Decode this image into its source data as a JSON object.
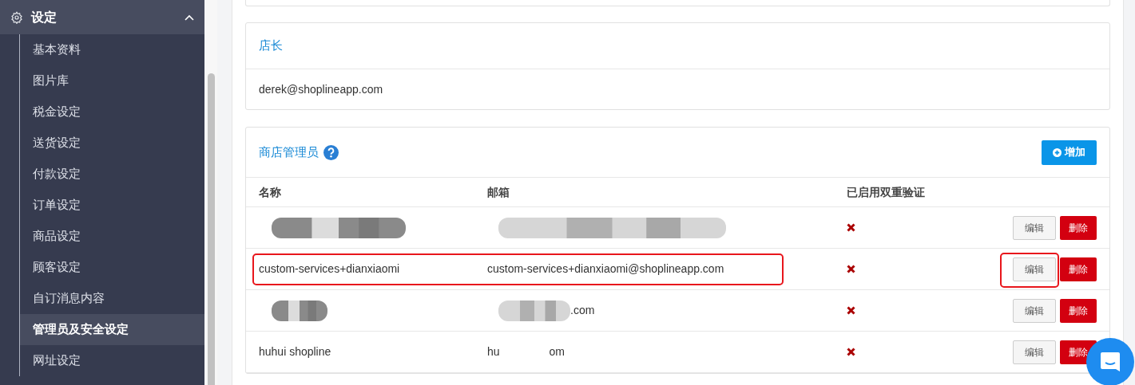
{
  "sidebar": {
    "section": {
      "label": "设定",
      "expanded": true
    },
    "items": [
      {
        "label": "基本资料",
        "selected": false
      },
      {
        "label": "图片库",
        "selected": false
      },
      {
        "label": "税金设定",
        "selected": false
      },
      {
        "label": "送货设定",
        "selected": false
      },
      {
        "label": "付款设定",
        "selected": false
      },
      {
        "label": "订单设定",
        "selected": false
      },
      {
        "label": "商品设定",
        "selected": false
      },
      {
        "label": "顾客设定",
        "selected": false
      },
      {
        "label": "自订消息内容",
        "selected": false
      },
      {
        "label": "管理员及安全设定",
        "selected": true
      },
      {
        "label": "网址设定",
        "selected": false
      }
    ]
  },
  "owner_card": {
    "title": "店长",
    "email": "derek@shoplineapp.com"
  },
  "admins_card": {
    "title": "商店管理员",
    "add_button": "增加",
    "columns": [
      "名称",
      "邮箱",
      "已启用双重验证"
    ],
    "rows": [
      {
        "name": "",
        "name_redacted": true,
        "email": "",
        "email_redacted": true,
        "two_factor": false,
        "highlighted": false,
        "edit_highlighted": false,
        "edit": "编辑",
        "delete": "删除"
      },
      {
        "name": "custom-services+dianxiaomi",
        "name_redacted": false,
        "email": "custom-services+dianxiaomi@shoplineapp.com",
        "email_redacted": false,
        "two_factor": false,
        "highlighted": true,
        "edit_highlighted": true,
        "edit": "编辑",
        "delete": "删除"
      },
      {
        "name": "",
        "name_redacted": true,
        "email": ".com",
        "email_redacted": true,
        "two_factor": false,
        "highlighted": false,
        "edit_highlighted": false,
        "edit": "编辑",
        "delete": "删除"
      },
      {
        "name": "huhui shopline",
        "name_redacted": false,
        "email": "hu",
        "email_tail": "om",
        "email_redacted": false,
        "two_factor": false,
        "highlighted": false,
        "edit_highlighted": false,
        "edit": "编辑",
        "delete": "删除"
      }
    ]
  }
}
